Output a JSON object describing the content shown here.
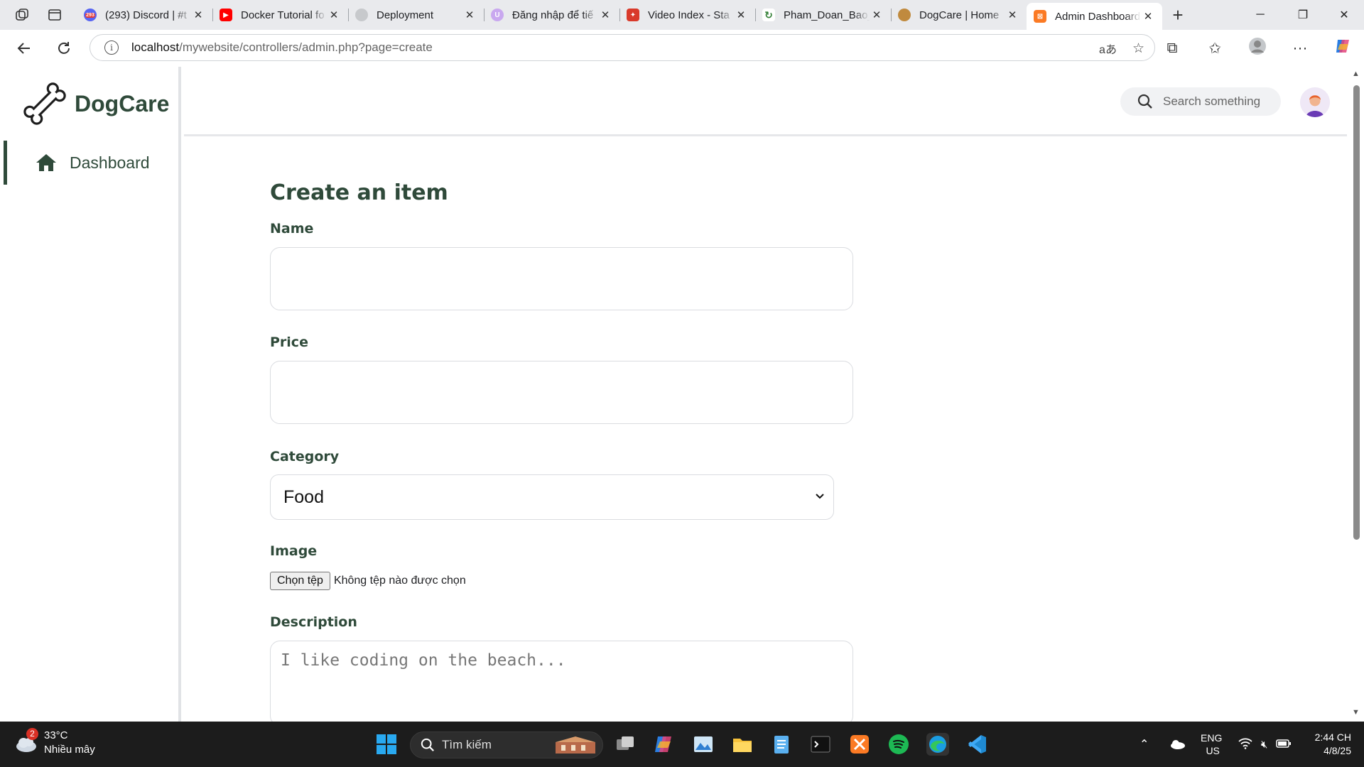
{
  "browser": {
    "tabs": [
      {
        "title": "(293) Discord | #t",
        "favicon": "discord-icon",
        "badge": "293",
        "color": "#5865f2"
      },
      {
        "title": "Docker Tutorial fo",
        "favicon": "youtube-icon",
        "color": "#ff0000"
      },
      {
        "title": "Deployment",
        "favicon": "octocat-icon",
        "color": "#9aa0a6"
      },
      {
        "title": "Đăng nhập để tiế",
        "favicon": "login-icon",
        "color": "#b388e8"
      },
      {
        "title": "Video Index - Sta",
        "favicon": "video-index-icon",
        "color": "#d93a2b"
      },
      {
        "title": "Pham_Doan_Bao_",
        "favicon": "sync-icon",
        "color": "#2e7d32"
      },
      {
        "title": "DogCare | Home",
        "favicon": "dogcare-icon",
        "color": "#c08a3e"
      },
      {
        "title": "Admin Dashboard",
        "favicon": "xampp-icon",
        "color": "#fb7a24",
        "active": true
      }
    ],
    "url_host": "localhost",
    "url_path": "/mywebsite/controllers/admin.php?page=create"
  },
  "sidebar": {
    "brand": "DogCare",
    "items": [
      {
        "label": "Dashboard",
        "icon": "home-icon",
        "active": true
      }
    ]
  },
  "topbar": {
    "search_placeholder": "Search something"
  },
  "form": {
    "title": "Create an item",
    "name_label": "Name",
    "name_value": "",
    "price_label": "Price",
    "price_value": "",
    "category_label": "Category",
    "category_value": "Food",
    "image_label": "Image",
    "file_button": "Chọn tệp",
    "file_status": "Không tệp nào được chọn",
    "description_label": "Description",
    "description_placeholder": "I like coding on the beach..."
  },
  "taskbar": {
    "weather_badge": "2",
    "temperature": "33°C",
    "weather_desc": "Nhiều mây",
    "search_placeholder": "Tìm kiếm",
    "lang_top": "ENG",
    "lang_bottom": "US",
    "time": "2:44 CH",
    "date": "4/8/25"
  },
  "colors": {
    "brand_green": "#2f4a3a",
    "active_tab": "#ffffff",
    "taskbar": "#1c1c1c"
  }
}
